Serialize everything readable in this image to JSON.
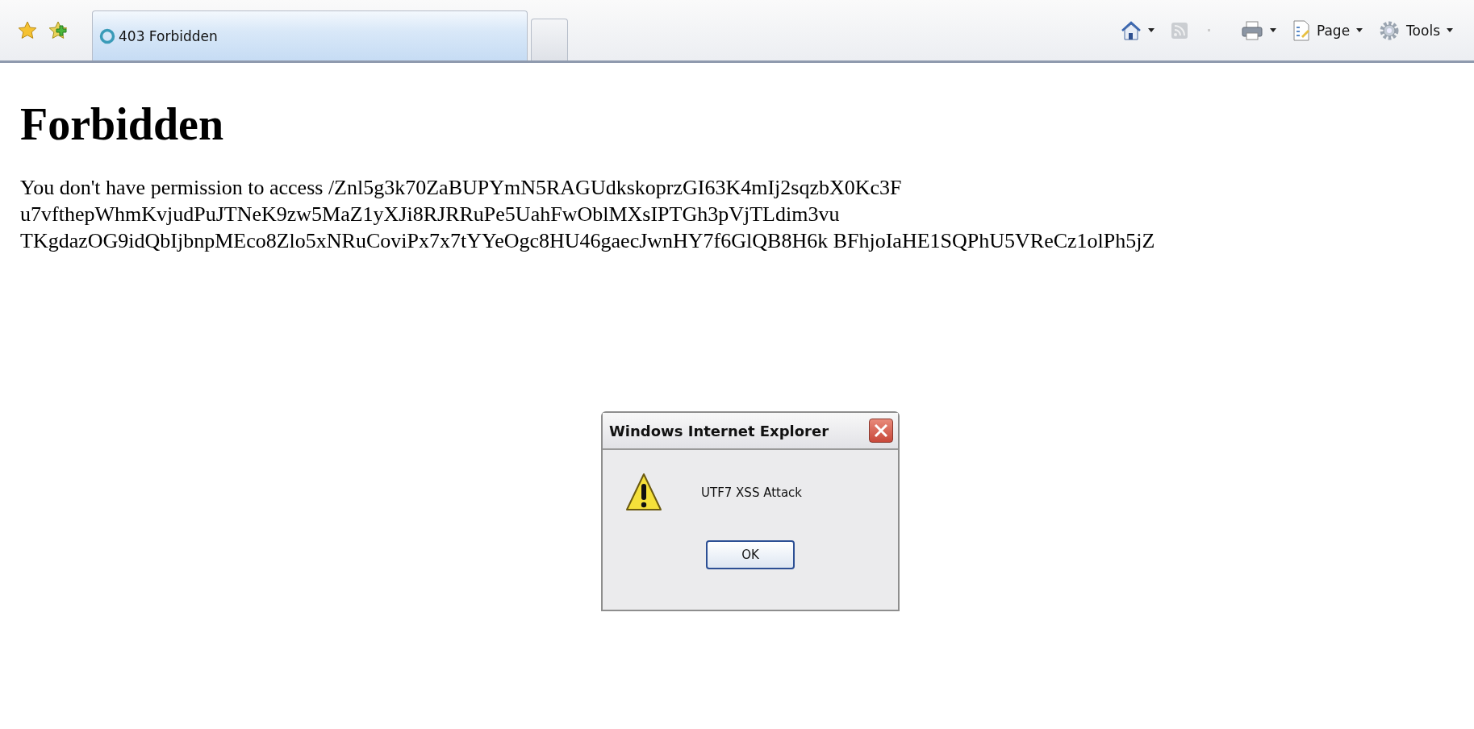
{
  "toolbar": {
    "tabs": [
      {
        "kind": "page",
        "title": "403 Forbidden",
        "selected": true
      },
      {
        "kind": "new",
        "selected": false
      }
    ],
    "feed_button": {
      "disabled": true
    },
    "menus": [
      {
        "label": "Page"
      },
      {
        "label": "Tools"
      }
    ]
  },
  "page": {
    "heading": "Forbidden",
    "message_lines": [
      "You don't have permission to access /Znl5g3k70ZaBUPYmN5RAGUdkskoprzGI63K4mIj2sqzbX0Kc3F",
      "u7vfthepWhmKvjudPuJTNeK9zw5MaZ1yXJi8RJRRuPe5UahFwOblMXsIPTGh3pVjTLdim3vu",
      "TKgdazOG9idQbIjbnpMEco8Zlo5xNRuCoviPx7x7tYYeOgc8HU46gaecJwnHY7f6GlQB8H6k BFhjoIaHE1SQPhU5VReCz1olPh5jZ"
    ]
  },
  "dialog": {
    "title": "Windows Internet Explorer",
    "message": "UTF7 XSS Attack",
    "buttons": [
      "OK"
    ]
  }
}
